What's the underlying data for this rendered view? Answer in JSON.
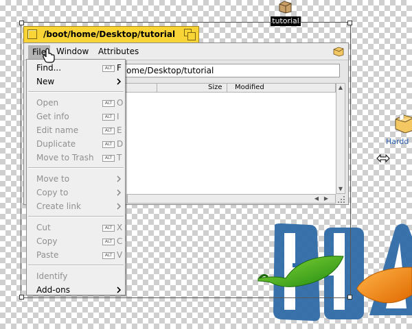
{
  "desktop": {
    "icons": [
      {
        "label": "tutorial",
        "icon": "folder-icon"
      },
      {
        "label": "Hardd",
        "icon": "folder-icon"
      }
    ]
  },
  "window": {
    "title": "/boot/home/Desktop/tutorial",
    "menubar": [
      "File",
      "Window",
      "Attributes"
    ],
    "path": "ome/Desktop/tutorial",
    "columns": {
      "size": "Size",
      "modified": "Modified"
    }
  },
  "file_menu": {
    "items": [
      {
        "label": "Find...",
        "alt": "ALT",
        "key": "F",
        "enabled": true
      },
      {
        "label": "New",
        "submenu": true,
        "enabled": true
      },
      {
        "label": "Open",
        "alt": "ALT",
        "key": "O",
        "enabled": false
      },
      {
        "label": "Get info",
        "alt": "ALT",
        "key": "I",
        "enabled": false
      },
      {
        "label": "Edit name",
        "alt": "ALT",
        "key": "E",
        "enabled": false
      },
      {
        "label": "Duplicate",
        "alt": "ALT",
        "key": "D",
        "enabled": false
      },
      {
        "label": "Move to Trash",
        "alt": "ALT",
        "key": "T",
        "enabled": false
      },
      {
        "label": "Move to",
        "submenu": true,
        "enabled": false
      },
      {
        "label": "Copy to",
        "submenu": true,
        "enabled": false
      },
      {
        "label": "Create link",
        "submenu": true,
        "enabled": false
      },
      {
        "label": "Cut",
        "alt": "ALT",
        "key": "X",
        "enabled": false
      },
      {
        "label": "Copy",
        "alt": "ALT",
        "key": "C",
        "enabled": false
      },
      {
        "label": "Paste",
        "alt": "ALT",
        "key": "V",
        "enabled": false
      },
      {
        "label": "Identify",
        "enabled": false
      },
      {
        "label": "Add-ons",
        "submenu": true,
        "enabled": true
      }
    ]
  },
  "colors": {
    "tab_yellow": "#f9d436",
    "logo_blue": "#2f6aa8",
    "leaf_green": "#3aa31d",
    "leaf_orange": "#f58a12"
  }
}
